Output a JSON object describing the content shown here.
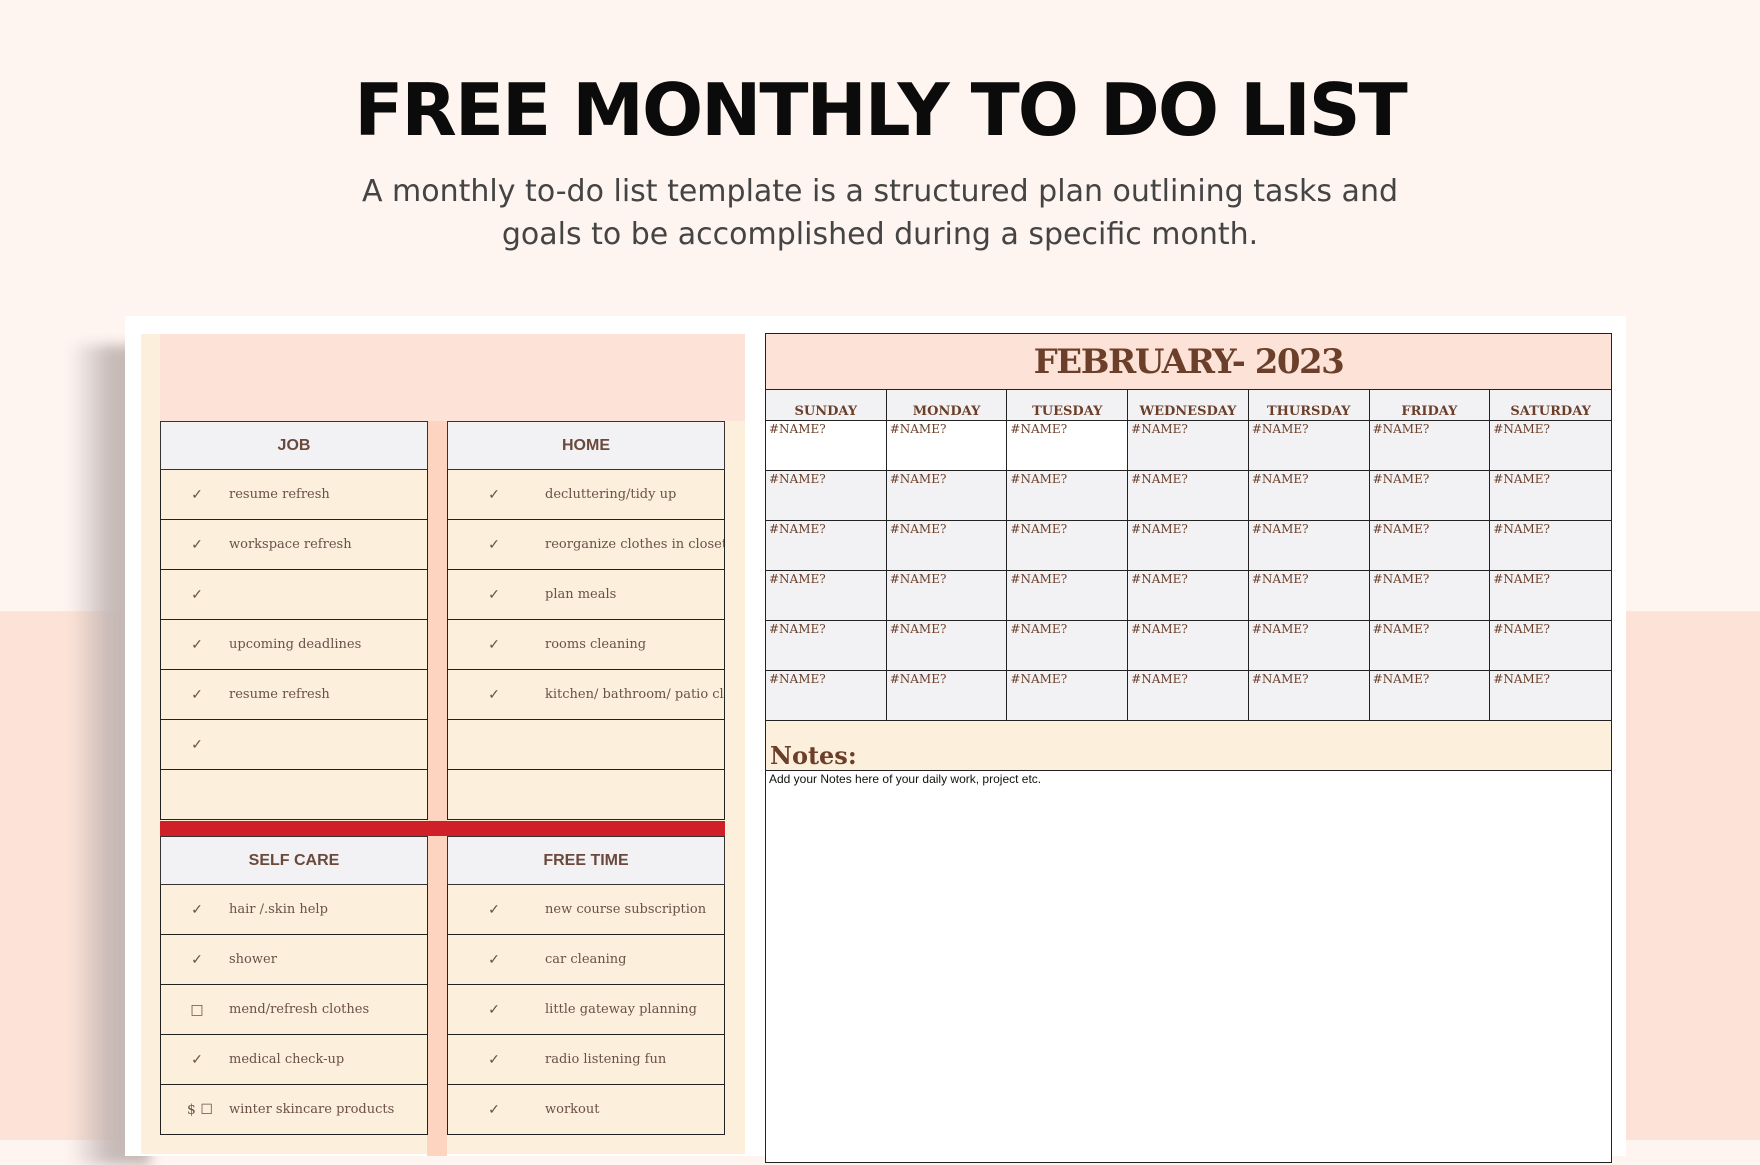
{
  "header": {
    "title": "FREE MONTHLY TO DO LIST",
    "subtitle_line1": "A monthly to-do list template is a structured plan outlining tasks and",
    "subtitle_line2": "goals to be accomplished during a specific month."
  },
  "lists": {
    "job": {
      "title": "JOB",
      "items": [
        {
          "mark": "✓",
          "text": "resume refresh"
        },
        {
          "mark": "✓",
          "text": "workspace refresh"
        },
        {
          "mark": "✓",
          "text": ""
        },
        {
          "mark": "✓",
          "text": "upcoming deadlines"
        },
        {
          "mark": "✓",
          "text": "resume refresh"
        },
        {
          "mark": "✓",
          "text": ""
        },
        {
          "mark": "",
          "text": ""
        }
      ]
    },
    "home": {
      "title": "HOME",
      "items": [
        {
          "mark": "✓",
          "text": "decluttering/tidy up"
        },
        {
          "mark": "✓",
          "text": "reorganize clothes in closet"
        },
        {
          "mark": "✓",
          "text": "plan meals"
        },
        {
          "mark": "✓",
          "text": "rooms cleaning"
        },
        {
          "mark": "✓",
          "text": "kitchen/ bathroom/ patio cleaning"
        },
        {
          "mark": "",
          "text": ""
        },
        {
          "mark": "",
          "text": ""
        }
      ]
    },
    "self_care": {
      "title": "SELF CARE",
      "items": [
        {
          "mark": "✓",
          "text": "hair /.skin help"
        },
        {
          "mark": "✓",
          "text": "shower"
        },
        {
          "mark": "□",
          "text": "mend/refresh clothes"
        },
        {
          "mark": "✓",
          "text": "medical check-up"
        },
        {
          "mark": "$ ☐",
          "text": "winter skincare products"
        }
      ]
    },
    "free_time": {
      "title": "FREE TIME",
      "items": [
        {
          "mark": "✓",
          "text": "new course subscription"
        },
        {
          "mark": "✓",
          "text": "car cleaning"
        },
        {
          "mark": "✓",
          "text": "little gateway planning"
        },
        {
          "mark": "✓",
          "text": "radio listening fun"
        },
        {
          "mark": "✓",
          "text": "workout"
        }
      ]
    }
  },
  "calendar": {
    "title": "FEBRUARY- 2023",
    "days": [
      "SUNDAY",
      "MONDAY",
      "TUESDAY",
      "WEDNESDAY",
      "THURSDAY",
      "FRIDAY",
      "SATURDAY"
    ],
    "cell_value": "#NAME?",
    "weeks": 6,
    "white_cells": [
      0,
      1,
      2
    ]
  },
  "notes": {
    "label": "Notes:",
    "text": "Add your Notes here of your daily work, project etc."
  },
  "colors": {
    "accent_red": "#cf2029",
    "peach": "#fde3d7",
    "cream": "#fcefdc",
    "brown_text": "#6b3f2a"
  }
}
